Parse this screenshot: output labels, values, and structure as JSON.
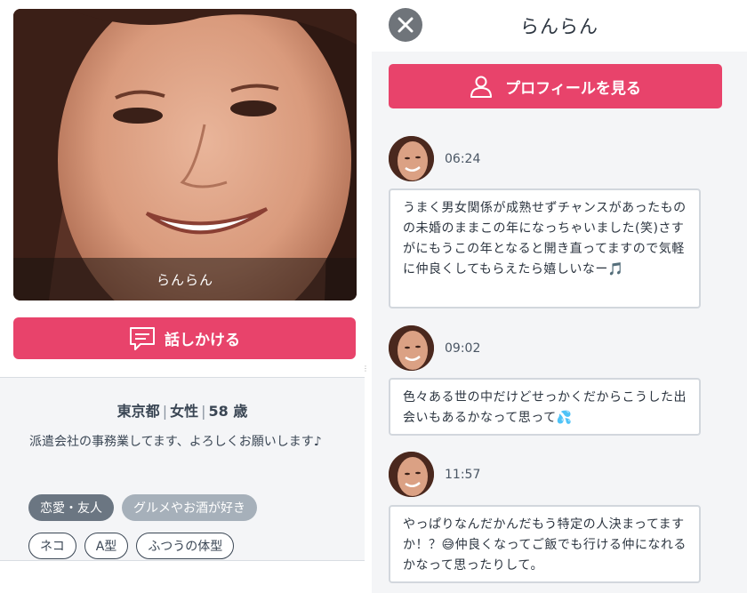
{
  "left": {
    "photo_caption": "らんらん",
    "talk_button_label": "話しかける",
    "meta": {
      "location": "東京都",
      "gender": "女性",
      "age": "58 歳"
    },
    "bio": "派遣会社の事務業してます、よろしくお願いします♪",
    "tags_filled": [
      "恋愛・友人",
      "グルメやお酒が好き"
    ],
    "tags_outline": [
      "ネコ",
      "A型",
      "ふつうの体型"
    ]
  },
  "right": {
    "title": "らんらん",
    "profile_button_label": "プロフィールを見る",
    "messages": [
      {
        "time": "06:24",
        "text": "うまく男女関係が成熟せずチャンスがあったものの未婚のままこの年になっちゃいました(笑)さすがにもうこの年となると開き直ってますので気軽に仲良くしてもらえたら嬉しいなー🎵"
      },
      {
        "time": "09:02",
        "text": "色々ある世の中だけどせっかくだからこうした出会いもあるかなって思って💦"
      },
      {
        "time": "11:57",
        "text": "やっぱりなんだかんだもう特定の人決まってますか！？😅仲良くなってご飯でも行ける仲になれるかなって思ったりして。"
      }
    ]
  },
  "colors": {
    "accent": "#e8436b",
    "tag_dark": "#6b7682",
    "tag_light": "#a6b0ba",
    "close_button": "#6f747a"
  },
  "icons": {
    "talk": "speech-bubble-icon",
    "profile": "person-icon",
    "close": "close-icon"
  }
}
